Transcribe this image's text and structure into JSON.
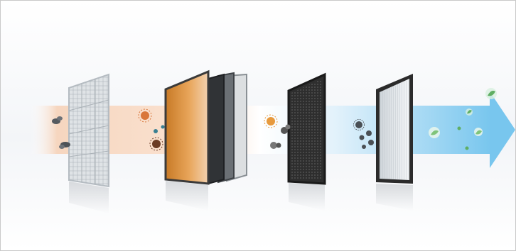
{
  "scene": {
    "colors": {
      "background": "#f3f5f8",
      "warm_air": "#f3c9a8",
      "cool_air": "#8fd0f2",
      "arrow_tip": "#6ec3ef",
      "hepa_cover": "#d2d7db",
      "carbon_mesh": "#e8a55a",
      "dark_frame": "#2b2b2b",
      "leaf": "#7fc47a"
    },
    "filters": [
      {
        "name": "pre-filter",
        "icon": "grid-mesh-filter-icon"
      },
      {
        "name": "antibacterial-carbon-filter-stack",
        "icon": "orange-mesh-filter-icon"
      },
      {
        "name": "deodorizing-filter",
        "icon": "black-honeycomb-filter-icon"
      },
      {
        "name": "hepa-filter",
        "icon": "pleated-white-filter-icon"
      }
    ],
    "particles": [
      {
        "name": "dust-particle",
        "icon": "dust-clump-icon"
      },
      {
        "name": "bacteria-particle",
        "icon": "germ-icon"
      },
      {
        "name": "odor-particle",
        "icon": "smoke-cluster-icon"
      },
      {
        "name": "clean-leaf",
        "icon": "leaf-bubble-icon"
      }
    ]
  }
}
